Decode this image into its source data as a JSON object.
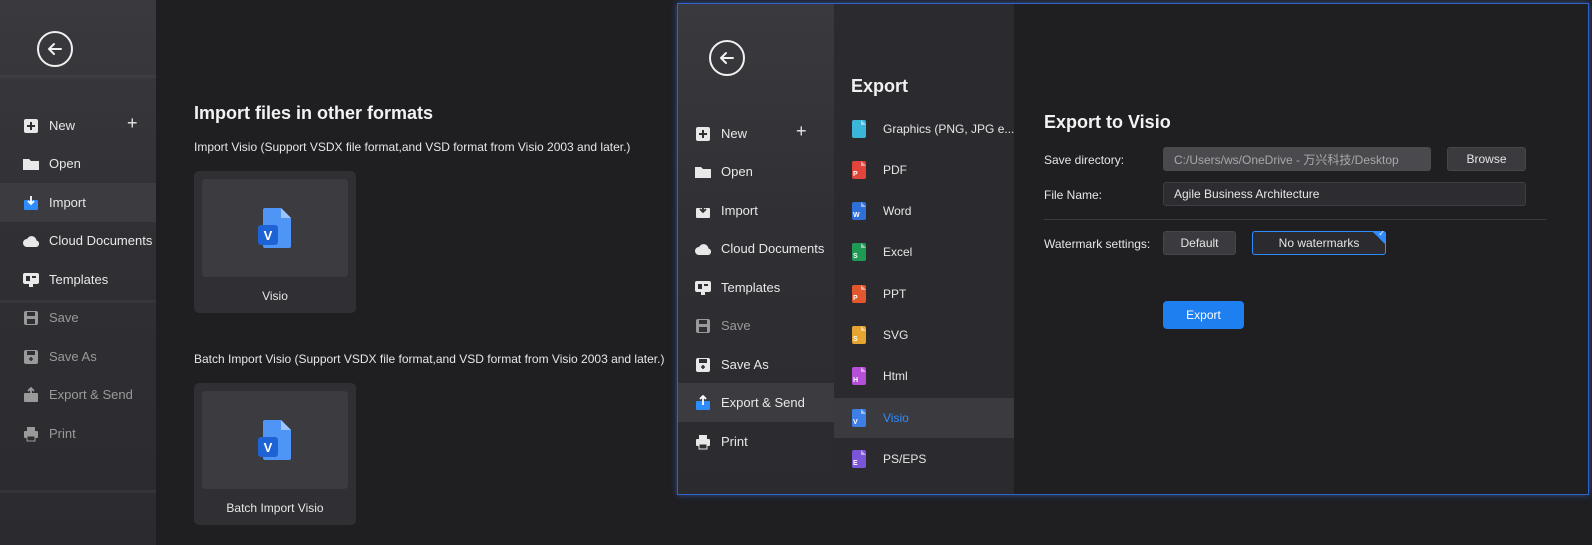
{
  "left": {
    "sidebar": {
      "items": [
        {
          "label": "New",
          "icon": "plus-square-icon",
          "disabled": false
        },
        {
          "label": "Open",
          "icon": "folder-icon",
          "disabled": false
        },
        {
          "label": "Import",
          "icon": "import-icon",
          "disabled": false,
          "active": true
        },
        {
          "label": "Cloud Documents",
          "icon": "cloud-icon",
          "disabled": false
        },
        {
          "label": "Templates",
          "icon": "templates-icon",
          "disabled": false
        },
        {
          "label": "Save",
          "icon": "save-icon",
          "disabled": true
        },
        {
          "label": "Save As",
          "icon": "save-as-icon",
          "disabled": true
        },
        {
          "label": "Export & Send",
          "icon": "export-icon",
          "disabled": true
        },
        {
          "label": "Print",
          "icon": "print-icon",
          "disabled": true
        }
      ]
    },
    "main": {
      "title": "Import files in other formats",
      "import_desc": "Import Visio (Support VSDX file format,and VSD format from Visio 2003 and later.)",
      "import_card_label": "Visio",
      "batch_desc": "Batch Import Visio (Support VSDX file format,and VSD format from Visio 2003 and later.)",
      "batch_card_label": "Batch Import Visio"
    }
  },
  "right": {
    "sidebar": {
      "items": [
        {
          "label": "New",
          "icon": "plus-square-icon"
        },
        {
          "label": "Open",
          "icon": "folder-icon"
        },
        {
          "label": "Import",
          "icon": "import-icon"
        },
        {
          "label": "Cloud Documents",
          "icon": "cloud-icon"
        },
        {
          "label": "Templates",
          "icon": "templates-icon"
        },
        {
          "label": "Save",
          "icon": "save-icon",
          "disabled": true
        },
        {
          "label": "Save As",
          "icon": "save-as-icon"
        },
        {
          "label": "Export & Send",
          "icon": "export-icon",
          "active": true
        },
        {
          "label": "Print",
          "icon": "print-icon"
        }
      ]
    },
    "export_menu": {
      "heading": "Export",
      "formats": [
        {
          "label": "Graphics (PNG, JPG e...",
          "color": "#3ab6d8",
          "glyph": ""
        },
        {
          "label": "PDF",
          "color": "#e0443a",
          "glyph": "P"
        },
        {
          "label": "Word",
          "color": "#2f6fd8",
          "glyph": "W"
        },
        {
          "label": "Excel",
          "color": "#1f9a55",
          "glyph": "S"
        },
        {
          "label": "PPT",
          "color": "#e2572e",
          "glyph": "P"
        },
        {
          "label": "SVG",
          "color": "#e6a530",
          "glyph": "S"
        },
        {
          "label": "Html",
          "color": "#b44fd6",
          "glyph": "H"
        },
        {
          "label": "Visio",
          "color": "#3d7fe6",
          "glyph": "V",
          "active": true
        },
        {
          "label": "PS/EPS",
          "color": "#7b55d8",
          "glyph": "E"
        }
      ]
    },
    "export_panel": {
      "title": "Export to Visio",
      "save_directory_label": "Save directory:",
      "save_directory_value": "C:/Users/ws/OneDrive - 万兴科技/Desktop",
      "browse_label": "Browse",
      "file_name_label": "File Name:",
      "file_name_value": "Agile Business Architecture",
      "watermark_label": "Watermark settings:",
      "watermark_default": "Default",
      "watermark_none": "No watermarks",
      "export_button": "Export",
      "accent_color": "#1e7ff0"
    }
  }
}
